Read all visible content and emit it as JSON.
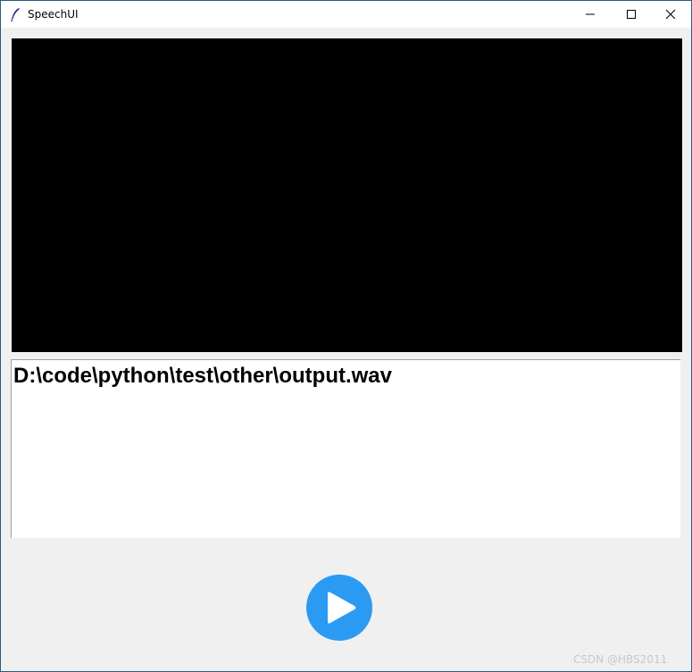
{
  "window": {
    "title": "SpeechUI"
  },
  "text_box": {
    "content": "D:\\code\\python\\test\\other\\output.wav"
  },
  "play_button": {
    "icon": "play-icon",
    "color": "#2b9af3"
  },
  "watermark": "CSDN @HBS2011"
}
